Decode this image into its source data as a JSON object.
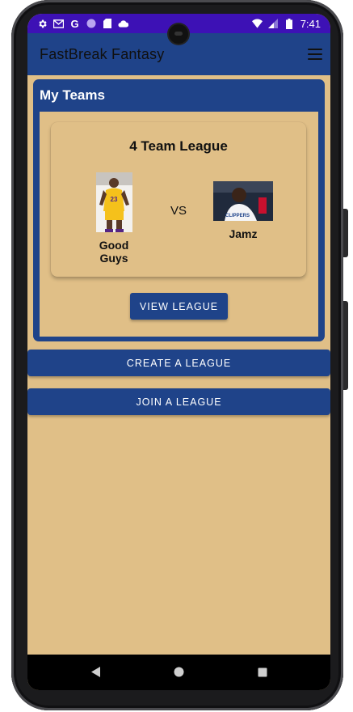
{
  "status_bar": {
    "time": "7:41",
    "left_icons": [
      "settings-icon",
      "gmail-icon",
      "google-icon",
      "circle-icon",
      "sd-card-icon",
      "cloud-icon"
    ],
    "right_icons": [
      "wifi-icon",
      "signal-icon",
      "battery-icon"
    ],
    "color": "#3d11b5"
  },
  "app_bar": {
    "title": "FastBreak Fantasy",
    "menu_icon": "hamburger-menu-icon",
    "color": "#1f4389"
  },
  "my_teams": {
    "heading": "My Teams",
    "league": {
      "name": "4 Team League",
      "vs_label": "VS",
      "team_home": {
        "name": "Good Guys",
        "image": "lakers-player-photo"
      },
      "team_away": {
        "name": "Jamz",
        "image": "clippers-player-photo"
      },
      "view_button": "VIEW LEAGUE"
    }
  },
  "actions": {
    "create_league": "CREATE A LEAGUE",
    "join_league": "JOIN A LEAGUE"
  },
  "nav": {
    "back": "back-icon",
    "home": "home-icon",
    "recents": "recents-icon"
  },
  "colors": {
    "background": "#e0bf87",
    "primary": "#1f4389"
  }
}
